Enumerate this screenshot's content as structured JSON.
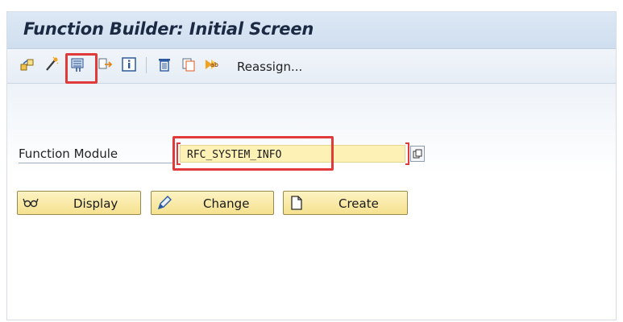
{
  "window": {
    "title": "Function Builder: Initial Screen"
  },
  "toolbar": {
    "icons": [
      "other-object-icon",
      "wizard-icon",
      "where-used-icon",
      "move-icon",
      "info-icon",
      "delete-icon",
      "copy-icon",
      "rename-icon"
    ],
    "reassign_label": "Reassign..."
  },
  "form": {
    "function_module_label": "Function Module",
    "function_module_value": "RFC_SYSTEM_INFO"
  },
  "buttons": {
    "display_label": "Display",
    "change_label": "Change",
    "create_label": "Create"
  },
  "colors": {
    "highlight": "#e03a3a",
    "input_bg": "#fdf1b6",
    "button_bg": "#f5e18f"
  }
}
